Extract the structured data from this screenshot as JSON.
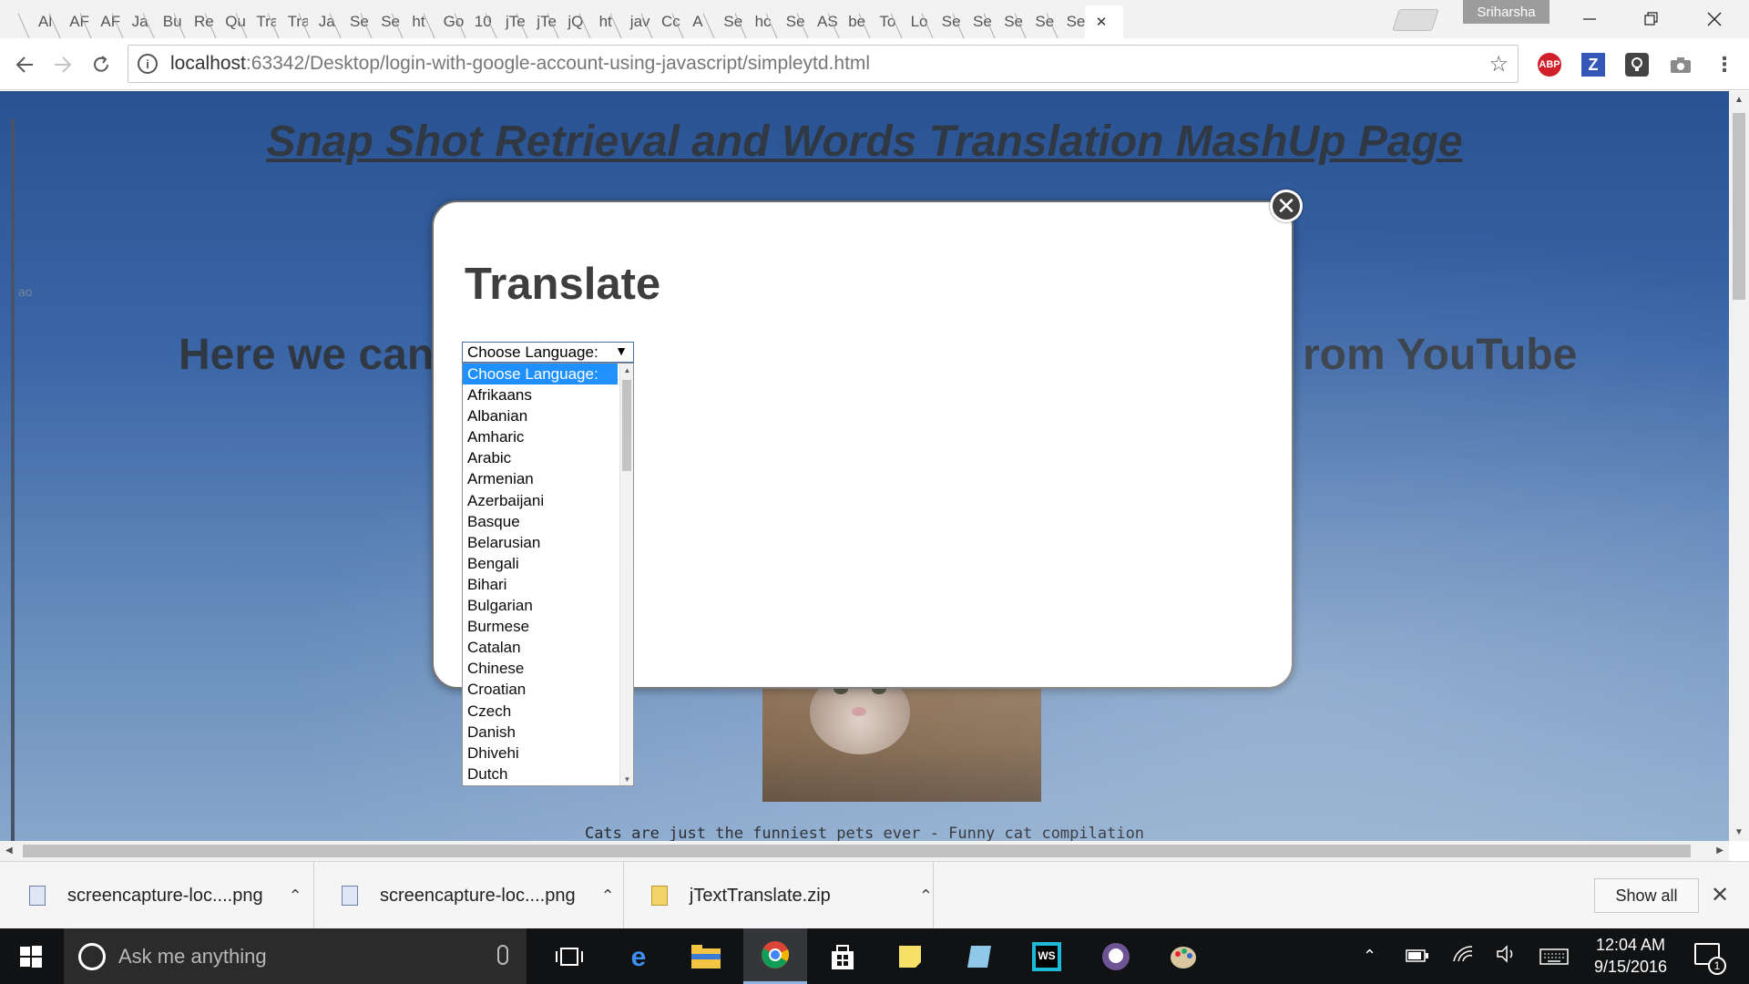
{
  "browser": {
    "tabs": [
      "Al",
      "AF",
      "AF",
      "Ja",
      "Bu",
      "Re",
      "Qu",
      "Tra",
      "Tra",
      "Ja",
      "Se",
      "Se",
      "ht",
      "Go",
      "10",
      "jTe",
      "jTe",
      "jQ",
      "ht",
      "jav",
      "Cc",
      "A",
      "Se",
      "hc",
      "Se",
      "AS",
      "be",
      "To",
      "Lo",
      "Se",
      "Se",
      "Se",
      "Se",
      "Se"
    ],
    "profile_name": "Sriharsha",
    "url_host": "localhost",
    "url_path": ":63342/Desktop/login-with-google-account-using-javascript/simpleytd.html",
    "extensions": [
      "ABP",
      "Z"
    ]
  },
  "page": {
    "title": "Snap Shot Retrieval and Words Translation MashUp Page",
    "subtitle_left": "Here we can",
    "subtitle_right": "rom YouTube",
    "video_caption": "Cats are just the funniest pets ever - Funny cat compilation",
    "side_mark": "ao"
  },
  "modal": {
    "title": "Translate",
    "close_label": "✕",
    "select_value": "Choose Language:",
    "options": [
      "Choose Language:",
      "Afrikaans",
      "Albanian",
      "Amharic",
      "Arabic",
      "Armenian",
      "Azerbaijani",
      "Basque",
      "Belarusian",
      "Bengali",
      "Bihari",
      "Bulgarian",
      "Burmese",
      "Catalan",
      "Chinese",
      "Croatian",
      "Czech",
      "Danish",
      "Dhivehi",
      "Dutch"
    ],
    "selected_index": 0
  },
  "downloads": {
    "items": [
      {
        "name": "screencapture-loc....png",
        "icon": "image-file-icon"
      },
      {
        "name": "screencapture-loc....png",
        "icon": "image-file-icon"
      },
      {
        "name": "jTextTranslate.zip",
        "icon": "zip-file-icon"
      }
    ],
    "show_all_label": "Show all"
  },
  "taskbar": {
    "search_placeholder": "Ask me anything",
    "time": "12:04 AM",
    "date": "9/15/2016",
    "notification_count": "1"
  },
  "colors": {
    "selected_option": "#1e90ff",
    "page_background": "#3e6cb0",
    "taskbar": "#101214"
  }
}
